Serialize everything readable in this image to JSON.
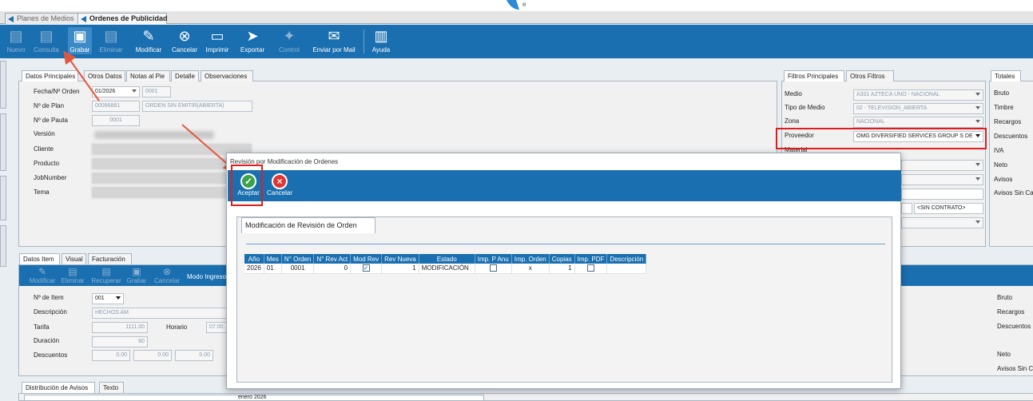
{
  "tabs": [
    {
      "label": "Planes de Medios"
    },
    {
      "label": "Ordenes de Publicidad"
    }
  ],
  "toolbar": {
    "nuevo": "Nuevo",
    "consulta": "Consulta",
    "grabar": "Grabar",
    "eliminar": "Eliminar",
    "modificar": "Modificar",
    "cancelar": "Cancelar",
    "imprimir": "Imprimir",
    "exportar": "Exportar",
    "control": "Control",
    "enviar_mail": "Enviar por Mail",
    "ayuda": "Ayuda"
  },
  "header_tabs": [
    "Datos Principales",
    "Otros Datos",
    "Notas al Pie",
    "Detalle",
    "Observaciones"
  ],
  "header": {
    "fecha_label": "Fecha/Nº Orden",
    "fecha_value": "01/2026",
    "orden_value": "0001",
    "plan_label": "Nº de Plan",
    "plan_value": "00096881",
    "plan_status": "ORDEN SIN EMITIR(ABIERTA)",
    "pauta_label": "Nº de Pauta",
    "pauta_value": "0001",
    "version_label": "Versión",
    "cliente_label": "Cliente",
    "producto_label": "Producto",
    "jobnumber_label": "JobNumber",
    "tema_label": "Tema"
  },
  "filtros": {
    "tabs": [
      "Filtros Principales",
      "Otros Filtros"
    ],
    "medio_label": "Medio",
    "medio_value": "A331 AZTECA UNO - NACIONAL",
    "tipo_label": "Tipo de Medio",
    "tipo_value": "02 - TELEVISION_ABIERTA",
    "zona_label": "Zona",
    "zona_value": "NACIONAL",
    "proveedor_label": "Proveedor",
    "proveedor_value": "OMG DIVERSIFIED SERVICES GROUP S DE",
    "material_label": "Material",
    "contrato_value": "<SIN CONTRATO>"
  },
  "totales": {
    "tab": "Totales",
    "items": [
      "Bruto",
      "Timbre",
      "Recargos",
      "Descuentos",
      "IVA",
      "Neto",
      "Avisos",
      "Avisos Sin Ca"
    ]
  },
  "item_tabs": [
    "Datos Item",
    "Visual",
    "Facturación"
  ],
  "item_toolbar": {
    "modificar": "Modificar",
    "eliminar": "Eliminar",
    "recuperar": "Recuperar",
    "grabar": "Grabar",
    "cancelar": "Cancelar",
    "modo": "Modo Ingreso"
  },
  "item": {
    "nro_label": "Nº de Item",
    "nro_value": "001",
    "desc_label": "Descripción",
    "desc_value": "HECHOS AM",
    "tarifa_label": "Tarifa",
    "tarifa_value": "1111.00",
    "horario_label": "Horario",
    "horario_value": "07:00",
    "duracion_label": "Duración",
    "duracion_value": "60",
    "desc2_label": "Descuentos",
    "d1": "0.00",
    "d2": "0.00",
    "d3": "0.00"
  },
  "item_totales": [
    "Bruto",
    "Recargos",
    "Descuentos",
    "Neto",
    "Avisos Sin Ca"
  ],
  "bottom_tabs": [
    "Distribución de Avisos",
    "Texto"
  ],
  "bottom_month": "enero 2026",
  "dialog": {
    "title": "Revisión por Modificación de Ordenes",
    "aceptar": "Aceptar",
    "cancelar": "Cancelar",
    "tab": "Modificación de Revisión de Orden",
    "columns": [
      "Año",
      "Mes",
      "N° Orden",
      "N° Rev Act",
      "Mod Rev",
      "Rev Nueva",
      "Estado",
      "Imp. P Anu",
      "Imp. Orden",
      "Copias",
      "Imp. PDF",
      "Descripción"
    ],
    "row": {
      "anio": "2026",
      "mes": "01",
      "orden": "0001",
      "rev_act": "0",
      "mod_rev": true,
      "rev_nueva": "1",
      "estado": "MODIFICACIÓN",
      "imp_p_anu": false,
      "imp_orden": "x",
      "copias": "1",
      "imp_pdf": false,
      "descripcion": ""
    }
  },
  "colors": {
    "accent": "#1a6fb0",
    "highlight": "#e01d1d"
  }
}
